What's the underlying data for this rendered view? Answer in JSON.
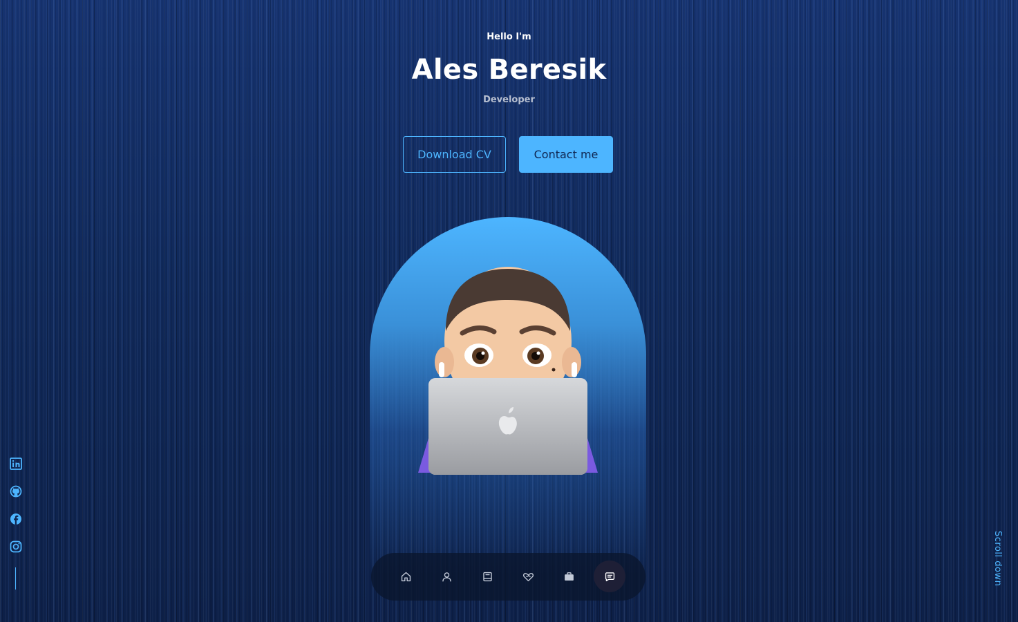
{
  "hero": {
    "greeting": "Hello I'm",
    "name": "Ales Beresik",
    "role": "Developer",
    "buttons": {
      "download_cv": "Download CV",
      "contact_me": "Contact me"
    }
  },
  "avatar": {
    "icon": "memoji-with-laptop"
  },
  "social_links": [
    {
      "icon": "linkedin-icon"
    },
    {
      "icon": "github-icon"
    },
    {
      "icon": "facebook-icon"
    },
    {
      "icon": "instagram-icon"
    }
  ],
  "scroll_down": "Scroll down",
  "nav": {
    "items": [
      {
        "icon": "home-icon",
        "active": false
      },
      {
        "icon": "user-icon",
        "active": false
      },
      {
        "icon": "book-icon",
        "active": false
      },
      {
        "icon": "services-icon",
        "active": false
      },
      {
        "icon": "briefcase-icon",
        "active": false
      },
      {
        "icon": "message-icon",
        "active": true
      }
    ]
  },
  "colors": {
    "accent": "#4db5ff",
    "background": "#0f2550",
    "nav_background": "#0a162d",
    "active_nav": "#1e1f36"
  }
}
